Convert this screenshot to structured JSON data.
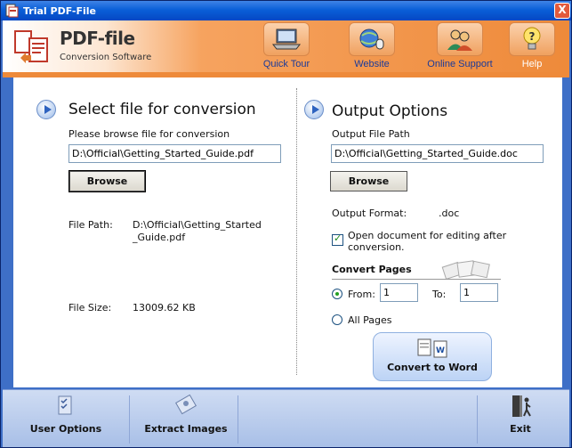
{
  "window": {
    "title": "Trial PDF-File",
    "close_glyph": "X"
  },
  "header": {
    "brand": "PDF-file",
    "tagline": "Conversion Software",
    "buttons": [
      {
        "label": "Quick Tour",
        "icon": "laptop-icon"
      },
      {
        "label": "Website",
        "icon": "globe-mouse-icon"
      },
      {
        "label": "Online Support",
        "icon": "support-people-icon"
      },
      {
        "label": "Help",
        "icon": "help-lightbulb-icon"
      }
    ]
  },
  "left": {
    "title": "Select file for conversion",
    "browse_prompt": "Please browse file for conversion",
    "input_value": "D:\\Official\\Getting_Started_Guide.pdf",
    "browse_label": "Browse",
    "file_path_label": "File Path:",
    "file_path_line1": "D:\\Official\\Getting_Started",
    "file_path_line2": "_Guide.pdf",
    "file_size_label": "File Size:",
    "file_size_value": "13009.62  KB"
  },
  "right": {
    "title": "Output Options",
    "output_path_label": "Output File Path",
    "output_path_value": "D:\\Official\\Getting_Started_Guide.doc",
    "browse_label": "Browse",
    "format_label": "Output Format:",
    "format_value": ".doc",
    "open_doc_line1": "Open document for editing after",
    "open_doc_line2": "conversion.",
    "open_doc_checked": true,
    "convert_pages_title": "Convert Pages",
    "from_label": "From:",
    "from_value": "1",
    "to_label": "To:",
    "to_value": "1",
    "all_pages_label": "All Pages",
    "selected_range": "from",
    "convert_label": "Convert to Word"
  },
  "footer": {
    "user_options": "User Options",
    "extract_images": "Extract Images",
    "exit": "Exit"
  },
  "colors": {
    "titlebar": "#0a5fd8",
    "header_orange": "#ee8a3a",
    "frame_blue": "#3e6fc7",
    "footer_blue": "#a8bfe7"
  }
}
